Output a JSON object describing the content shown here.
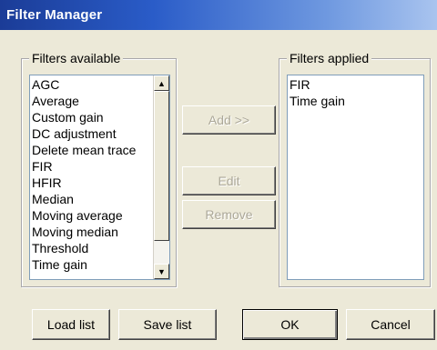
{
  "window": {
    "title": "Filter Manager"
  },
  "available": {
    "label": "Filters available",
    "items": [
      "AGC",
      "Average",
      "Custom gain",
      "DC adjustment",
      "Delete mean trace",
      "FIR",
      "HFIR",
      "Median",
      "Moving average",
      "Moving median",
      "Threshold",
      "Time gain"
    ]
  },
  "applied": {
    "label": "Filters applied",
    "items": [
      "FIR",
      "Time gain"
    ]
  },
  "buttons": {
    "add": "Add >>",
    "edit": "Edit",
    "remove": "Remove",
    "load": "Load list",
    "save": "Save list",
    "ok": "OK",
    "cancel": "Cancel"
  },
  "scrollbar": {
    "up_icon": "triangle-up",
    "down_icon": "triangle-down"
  }
}
